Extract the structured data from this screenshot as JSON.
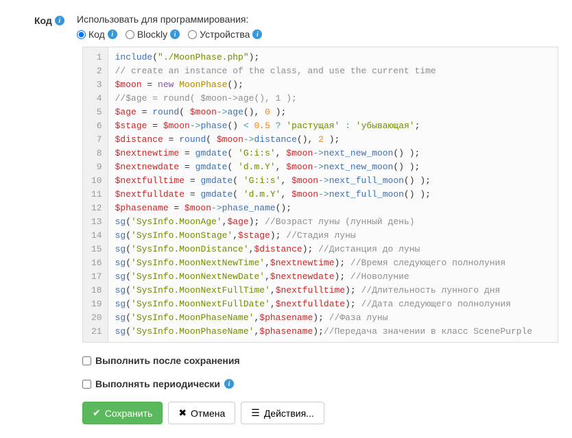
{
  "field": {
    "label": "Код",
    "description": "Использовать для программирования:"
  },
  "radios": {
    "code": "Код",
    "blockly": "Blockly",
    "devices": "Устройства"
  },
  "code_lines": [
    [
      [
        "fn",
        "include"
      ],
      [
        "",
        "("
      ],
      [
        "str",
        "\"./MoonPhase.php\""
      ],
      [
        "",
        ");"
      ]
    ],
    [
      [
        "comment",
        "// create an instance of the class, and use the current time"
      ]
    ],
    [
      [
        "var",
        "$moon"
      ],
      [
        "",
        " = "
      ],
      [
        "kw",
        "new"
      ],
      [
        "",
        " "
      ],
      [
        "type",
        "MoonPhase"
      ],
      [
        "",
        "();"
      ]
    ],
    [
      [
        "comment",
        "//$age = round( $moon->age(), 1 );"
      ]
    ],
    [
      [
        "var",
        "$age"
      ],
      [
        "",
        " = "
      ],
      [
        "fn",
        "round"
      ],
      [
        "",
        "( "
      ],
      [
        "var",
        "$moon"
      ],
      [
        "op",
        "->"
      ],
      [
        "fn",
        "age"
      ],
      [
        "",
        "(), "
      ],
      [
        "num",
        "0"
      ],
      [
        "",
        " );"
      ]
    ],
    [
      [
        "var",
        "$stage"
      ],
      [
        "",
        " = "
      ],
      [
        "var",
        "$moon"
      ],
      [
        "op",
        "->"
      ],
      [
        "fn",
        "phase"
      ],
      [
        "",
        "() "
      ],
      [
        "op",
        "<"
      ],
      [
        "",
        " "
      ],
      [
        "num",
        "0.5"
      ],
      [
        "",
        " "
      ],
      [
        "op",
        "?"
      ],
      [
        "",
        " "
      ],
      [
        "str",
        "'растущая'"
      ],
      [
        "",
        " "
      ],
      [
        "op",
        ":"
      ],
      [
        "",
        " "
      ],
      [
        "str",
        "'убывающая'"
      ],
      [
        "",
        ";"
      ]
    ],
    [
      [
        "var",
        "$distance"
      ],
      [
        "",
        " = "
      ],
      [
        "fn",
        "round"
      ],
      [
        "",
        "( "
      ],
      [
        "var",
        "$moon"
      ],
      [
        "op",
        "->"
      ],
      [
        "fn",
        "distance"
      ],
      [
        "",
        "(), "
      ],
      [
        "num",
        "2"
      ],
      [
        "",
        " );"
      ]
    ],
    [
      [
        "var",
        "$nextnewtime"
      ],
      [
        "",
        " = "
      ],
      [
        "fn",
        "gmdate"
      ],
      [
        "",
        "( "
      ],
      [
        "str",
        "'G:i:s'"
      ],
      [
        "",
        ", "
      ],
      [
        "var",
        "$moon"
      ],
      [
        "op",
        "->"
      ],
      [
        "fn",
        "next_new_moon"
      ],
      [
        "",
        "() );"
      ]
    ],
    [
      [
        "var",
        "$nextnewdate"
      ],
      [
        "",
        " = "
      ],
      [
        "fn",
        "gmdate"
      ],
      [
        "",
        "( "
      ],
      [
        "str",
        "'d.m.Y'"
      ],
      [
        "",
        ", "
      ],
      [
        "var",
        "$moon"
      ],
      [
        "op",
        "->"
      ],
      [
        "fn",
        "next_new_moon"
      ],
      [
        "",
        "() );"
      ]
    ],
    [
      [
        "var",
        "$nextfulltime"
      ],
      [
        "",
        " = "
      ],
      [
        "fn",
        "gmdate"
      ],
      [
        "",
        "( "
      ],
      [
        "str",
        "'G:i:s'"
      ],
      [
        "",
        ", "
      ],
      [
        "var",
        "$moon"
      ],
      [
        "op",
        "->"
      ],
      [
        "fn",
        "next_full_moon"
      ],
      [
        "",
        "() );"
      ]
    ],
    [
      [
        "var",
        "$nextfulldate"
      ],
      [
        "",
        " = "
      ],
      [
        "fn",
        "gmdate"
      ],
      [
        "",
        "( "
      ],
      [
        "str",
        "'d.m.Y'"
      ],
      [
        "",
        ", "
      ],
      [
        "var",
        "$moon"
      ],
      [
        "op",
        "->"
      ],
      [
        "fn",
        "next_full_moon"
      ],
      [
        "",
        "() );"
      ]
    ],
    [
      [
        "var",
        "$phasename"
      ],
      [
        "",
        " = "
      ],
      [
        "var",
        "$moon"
      ],
      [
        "op",
        "->"
      ],
      [
        "fn",
        "phase_name"
      ],
      [
        "",
        "();"
      ]
    ],
    [
      [
        "fn",
        "sg"
      ],
      [
        "",
        "("
      ],
      [
        "str",
        "'SysInfo.MoonAge'"
      ],
      [
        "",
        ","
      ],
      [
        "var",
        "$age"
      ],
      [
        "",
        "); "
      ],
      [
        "comment",
        "//Возраст луны (лунный день)"
      ]
    ],
    [
      [
        "fn",
        "sg"
      ],
      [
        "",
        "("
      ],
      [
        "str",
        "'SysInfo.MoonStage'"
      ],
      [
        "",
        ","
      ],
      [
        "var",
        "$stage"
      ],
      [
        "",
        "); "
      ],
      [
        "comment",
        "//Стадия луны"
      ]
    ],
    [
      [
        "fn",
        "sg"
      ],
      [
        "",
        "("
      ],
      [
        "str",
        "'SysInfo.MoonDistance'"
      ],
      [
        "",
        ","
      ],
      [
        "var",
        "$distance"
      ],
      [
        "",
        "); "
      ],
      [
        "comment",
        "//Дистанция до луны"
      ]
    ],
    [
      [
        "fn",
        "sg"
      ],
      [
        "",
        "("
      ],
      [
        "str",
        "'SysInfo.MoonNextNewTime'"
      ],
      [
        "",
        ","
      ],
      [
        "var",
        "$nextnewtime"
      ],
      [
        "",
        "); "
      ],
      [
        "comment",
        "//Время следующего полнолуния"
      ]
    ],
    [
      [
        "fn",
        "sg"
      ],
      [
        "",
        "("
      ],
      [
        "str",
        "'SysInfo.MoonNextNewDate'"
      ],
      [
        "",
        ","
      ],
      [
        "var",
        "$nextnewdate"
      ],
      [
        "",
        "); "
      ],
      [
        "comment",
        "//Новолуние"
      ]
    ],
    [
      [
        "fn",
        "sg"
      ],
      [
        "",
        "("
      ],
      [
        "str",
        "'SysInfo.MoonNextFullTime'"
      ],
      [
        "",
        ","
      ],
      [
        "var",
        "$nextfulltime"
      ],
      [
        "",
        "); "
      ],
      [
        "comment",
        "//Длительность лунного дня"
      ]
    ],
    [
      [
        "fn",
        "sg"
      ],
      [
        "",
        "("
      ],
      [
        "str",
        "'SysInfo.MoonNextFullDate'"
      ],
      [
        "",
        ","
      ],
      [
        "var",
        "$nextfulldate"
      ],
      [
        "",
        "); "
      ],
      [
        "comment",
        "//Дата следующего полнолуния"
      ]
    ],
    [
      [
        "fn",
        "sg"
      ],
      [
        "",
        "("
      ],
      [
        "str",
        "'SysInfo.MoonPhaseName'"
      ],
      [
        "",
        ","
      ],
      [
        "var",
        "$phasename"
      ],
      [
        "",
        "); "
      ],
      [
        "comment",
        "//Фаза луны"
      ]
    ],
    [
      [
        "fn",
        "sg"
      ],
      [
        "",
        "("
      ],
      [
        "str",
        "'SysInfo.MoonPhaseName'"
      ],
      [
        "",
        ","
      ],
      [
        "var",
        "$phasename"
      ],
      [
        "",
        ");"
      ],
      [
        "comment",
        "//Передача значении в класс ScenePurple"
      ]
    ]
  ],
  "checkboxes": {
    "run_after_save": "Выполнить после сохранения",
    "run_periodically": "Выполнять периодически"
  },
  "buttons": {
    "save": "Сохранить",
    "cancel": "Отмена",
    "actions": "Действия..."
  }
}
